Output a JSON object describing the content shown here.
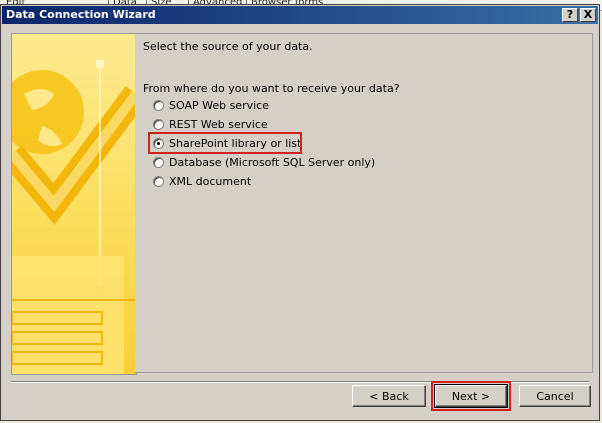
{
  "background_tabs": [
    "Edit",
    "Data",
    "Size",
    "Advanced",
    "Browser forms"
  ],
  "titlebar": {
    "title": "Data Connection Wizard",
    "help_label": "?",
    "close_label": "X"
  },
  "main": {
    "heading": "Select the source of your data.",
    "question": "From where do you want to receive your data?",
    "options": [
      {
        "label": "SOAP Web service",
        "selected": false
      },
      {
        "label": "REST Web service",
        "selected": false
      },
      {
        "label": "SharePoint library or list",
        "selected": true
      },
      {
        "label": "Database (Microsoft SQL Server only)",
        "selected": false
      },
      {
        "label": "XML document",
        "selected": false
      }
    ]
  },
  "buttons": {
    "back_label": "< Back",
    "next_label": "Next >",
    "cancel_label": "Cancel"
  },
  "colors": {
    "highlight": "#d4201c",
    "title_start": "#0a246a",
    "title_end": "#3a6ea5",
    "art_yellow": "#f7d21a"
  }
}
